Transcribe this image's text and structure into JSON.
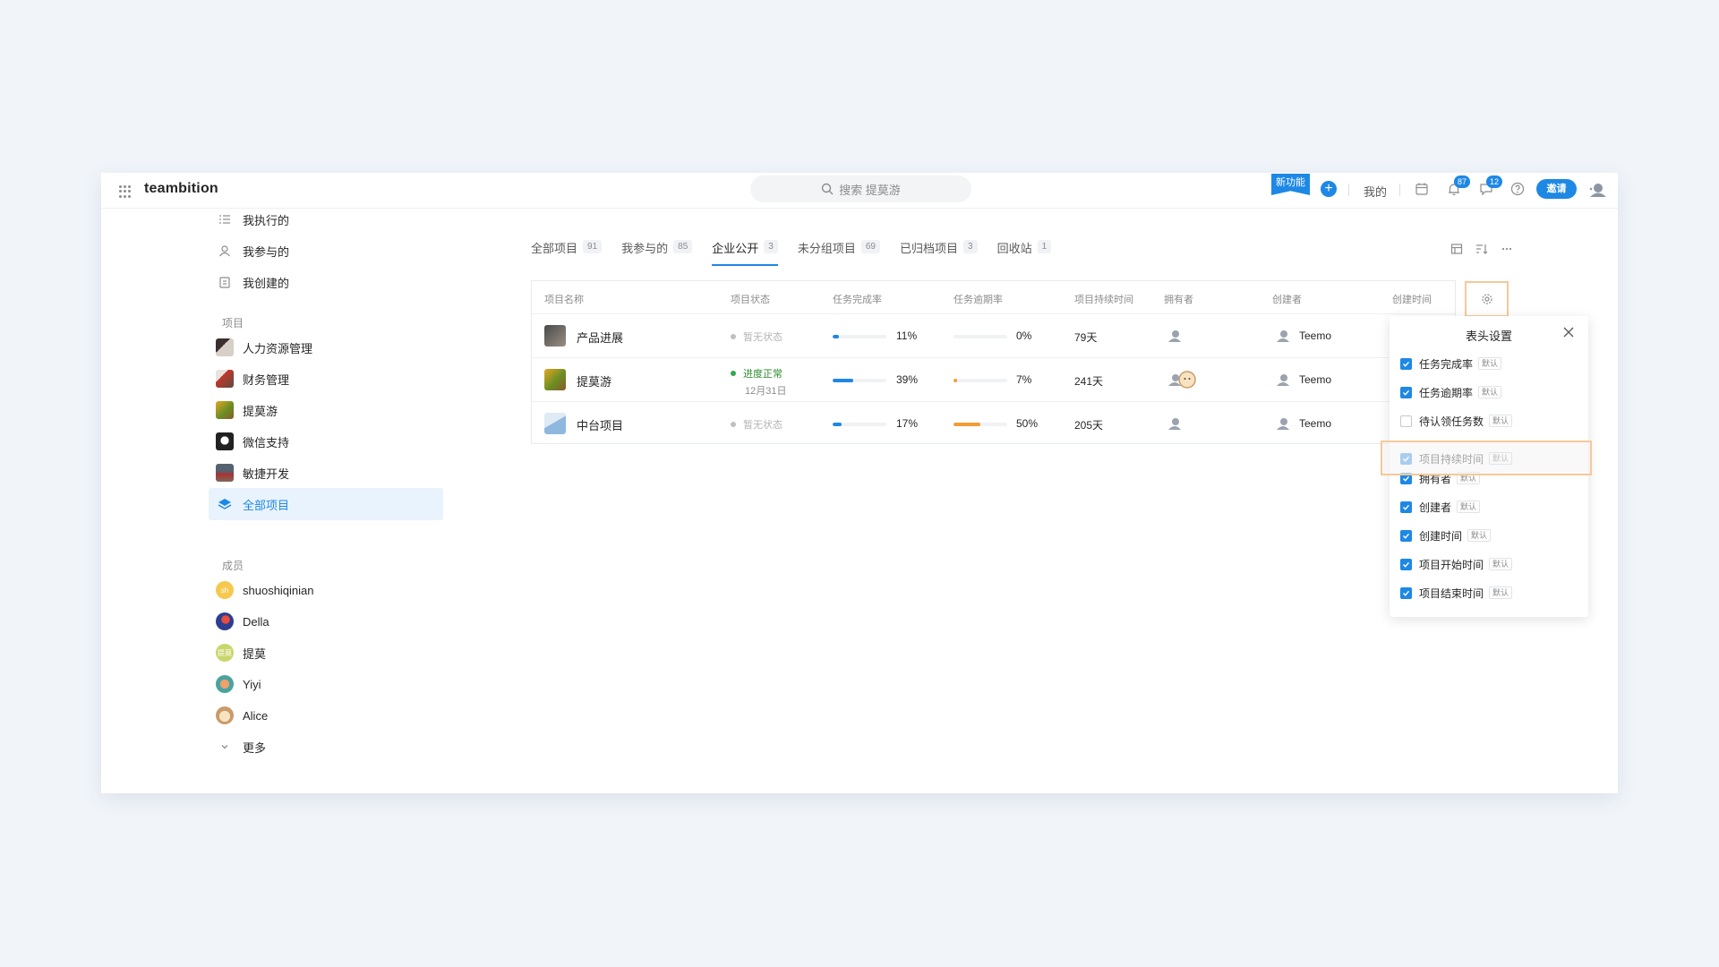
{
  "app": {
    "logo": "teambition"
  },
  "header": {
    "search_placeholder": "搜索 提莫游",
    "new_feature_label": "新功能",
    "mine_label": "我的",
    "notifications_count": "87",
    "messages_count": "12",
    "invite_label": "邀请",
    "accent": "#1e88e5"
  },
  "sidebar": {
    "my_items": [
      {
        "label": "我执行的",
        "icon": "task-list-icon"
      },
      {
        "label": "我参与的",
        "icon": "person-icon"
      },
      {
        "label": "我创建的",
        "icon": "clipboard-icon"
      }
    ],
    "projects_heading": "项目",
    "projects": [
      {
        "label": "人力资源管理"
      },
      {
        "label": "财务管理"
      },
      {
        "label": "提莫游"
      },
      {
        "label": "微信支持"
      },
      {
        "label": "敏捷开发"
      },
      {
        "label": "全部项目",
        "active": true
      }
    ],
    "members_heading": "成员",
    "members": [
      {
        "label": "shuoshiqinian",
        "initials": "sh"
      },
      {
        "label": "Della"
      },
      {
        "label": "提莫",
        "initials": "提莫"
      },
      {
        "label": "Yiyi"
      },
      {
        "label": "Alice"
      }
    ],
    "more_label": "更多"
  },
  "tabs": [
    {
      "label": "全部项目",
      "count": "91"
    },
    {
      "label": "我参与的",
      "count": "85"
    },
    {
      "label": "企业公开",
      "count": "3",
      "active": true
    },
    {
      "label": "未分组项目",
      "count": "69"
    },
    {
      "label": "已归档项目",
      "count": "3"
    },
    {
      "label": "回收站",
      "count": "1"
    }
  ],
  "table": {
    "columns": [
      "项目名称",
      "项目状态",
      "任务完成率",
      "任务逾期率",
      "项目持续时间",
      "拥有者",
      "创建者",
      "创建时间"
    ],
    "rows": [
      {
        "name": "产品进展",
        "status": "暂无状态",
        "completion": "11%",
        "completion_value": 0.11,
        "overdue": "0%",
        "overdue_value": 0.0,
        "duration": "79天",
        "creator": "Teemo"
      },
      {
        "name": "提莫游",
        "status": "进度正常",
        "status_date": "12月31日",
        "completion": "39%",
        "completion_value": 0.39,
        "overdue": "7%",
        "overdue_value": 0.07,
        "duration": "241天",
        "creator": "Teemo"
      },
      {
        "name": "中台项目",
        "status": "暂无状态",
        "completion": "17%",
        "completion_value": 0.17,
        "overdue": "50%",
        "overdue_value": 0.5,
        "duration": "205天",
        "creator": "Teemo"
      }
    ]
  },
  "popup": {
    "title": "表头设置",
    "default_tag": "默认",
    "options": [
      {
        "label": "任务完成率",
        "checked": true
      },
      {
        "label": "任务逾期率",
        "checked": true
      },
      {
        "label": "待认领任务数",
        "checked": false
      },
      {
        "label": "项目持续时间",
        "checked": true,
        "dragging": true
      },
      {
        "label": "拥有者",
        "checked": true
      },
      {
        "label": "创建者",
        "checked": true
      },
      {
        "label": "创建时间",
        "checked": true
      },
      {
        "label": "项目开始时间",
        "checked": true
      },
      {
        "label": "项目结束时间",
        "checked": true
      }
    ]
  }
}
